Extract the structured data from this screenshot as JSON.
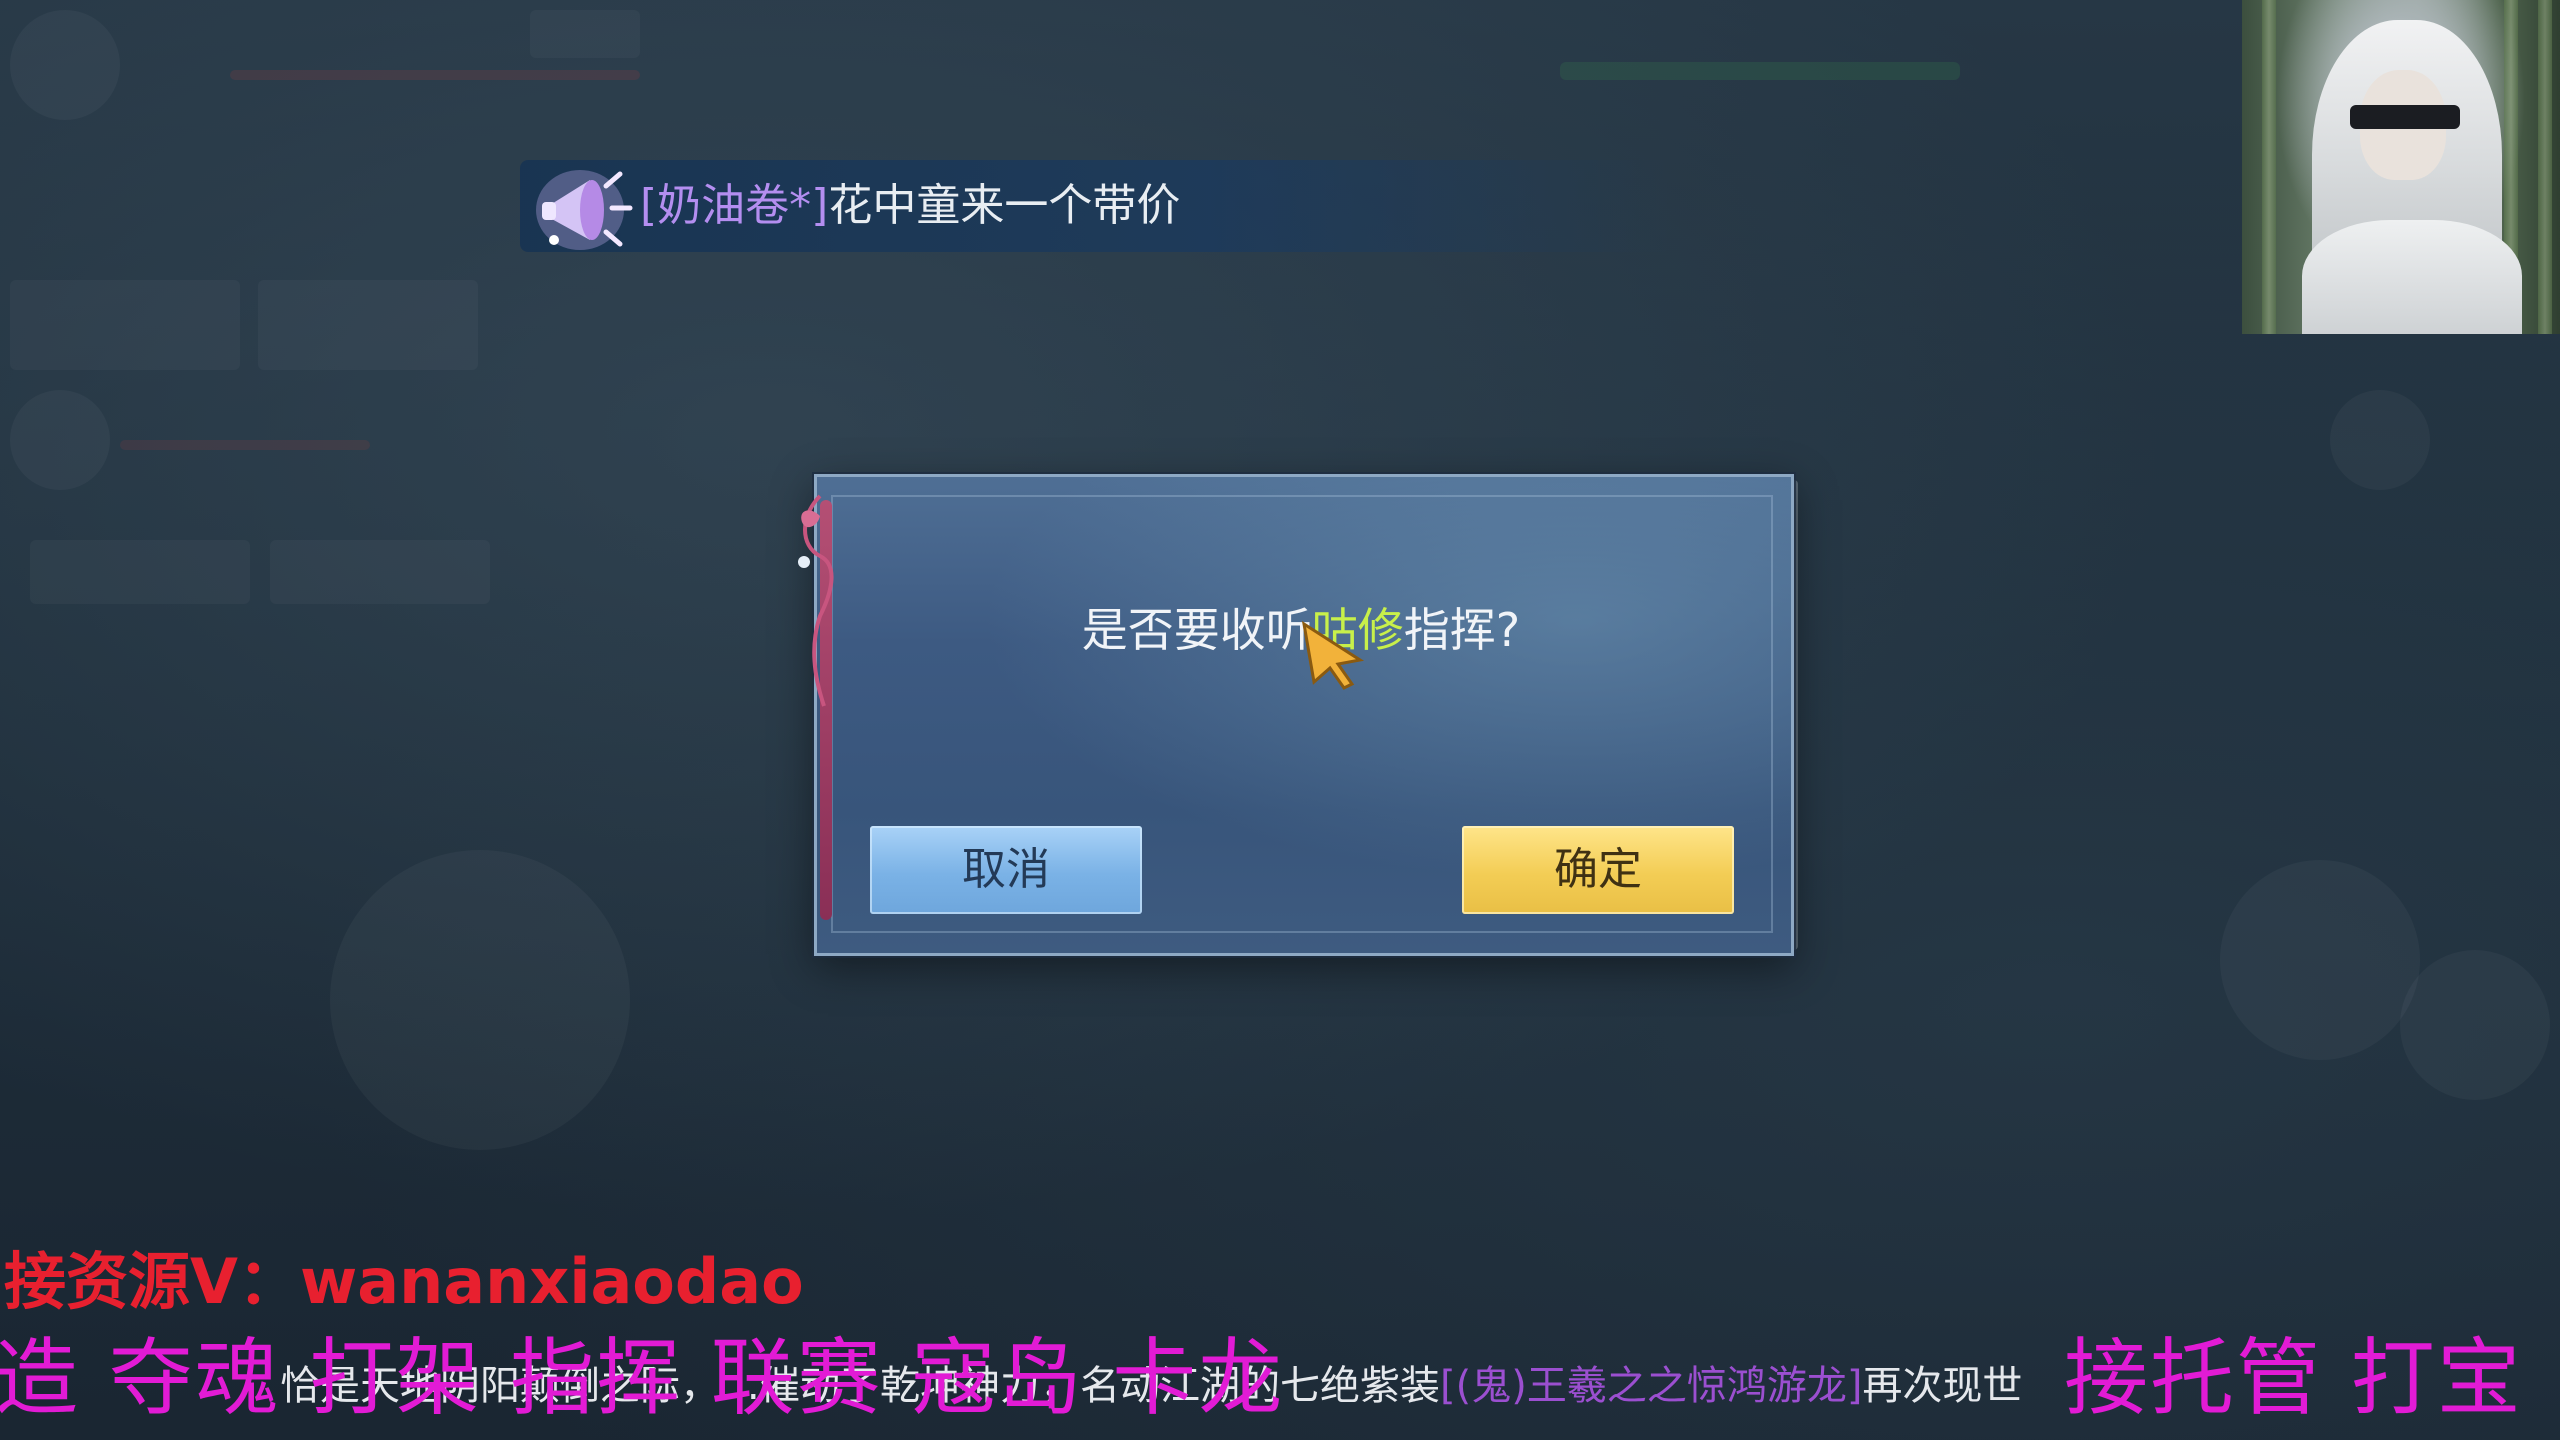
{
  "broadcast": {
    "sender": "[奶油卷*]",
    "message": "花中童来一个带价",
    "icon": "megaphone-icon"
  },
  "dialog": {
    "message_prefix": "是否要收听",
    "commander_name": "咕修",
    "message_suffix": "指挥?",
    "cancel_label": "取消",
    "confirm_label": "确定"
  },
  "watermark": {
    "contact": "接资源V：wananxiaodao",
    "services_left": "造 夺魂 打架 指挥 联赛 寇岛 卡龙",
    "services_right": "接托管 打宝"
  },
  "subtitle": {
    "part1": "恰是天地阴阳颠倒之际，",
    "part2": "[(鬼)王羲之之惊鸿游龙]",
    "part3": "再次现世",
    "full_line": "恰是天地阴阳颠倒之际，…催动了乾坤神力，名动江湖的七绝紫装"
  },
  "colors": {
    "dialog_bg": "#3d5a82",
    "cancel_button": "#7ab2e6",
    "confirm_button": "#f3cd55",
    "commander_highlight": "#c8f04a",
    "broadcast_sender": "#b48ef0",
    "watermark_red": "#e8202f",
    "watermark_magenta": "#e21bd5"
  }
}
